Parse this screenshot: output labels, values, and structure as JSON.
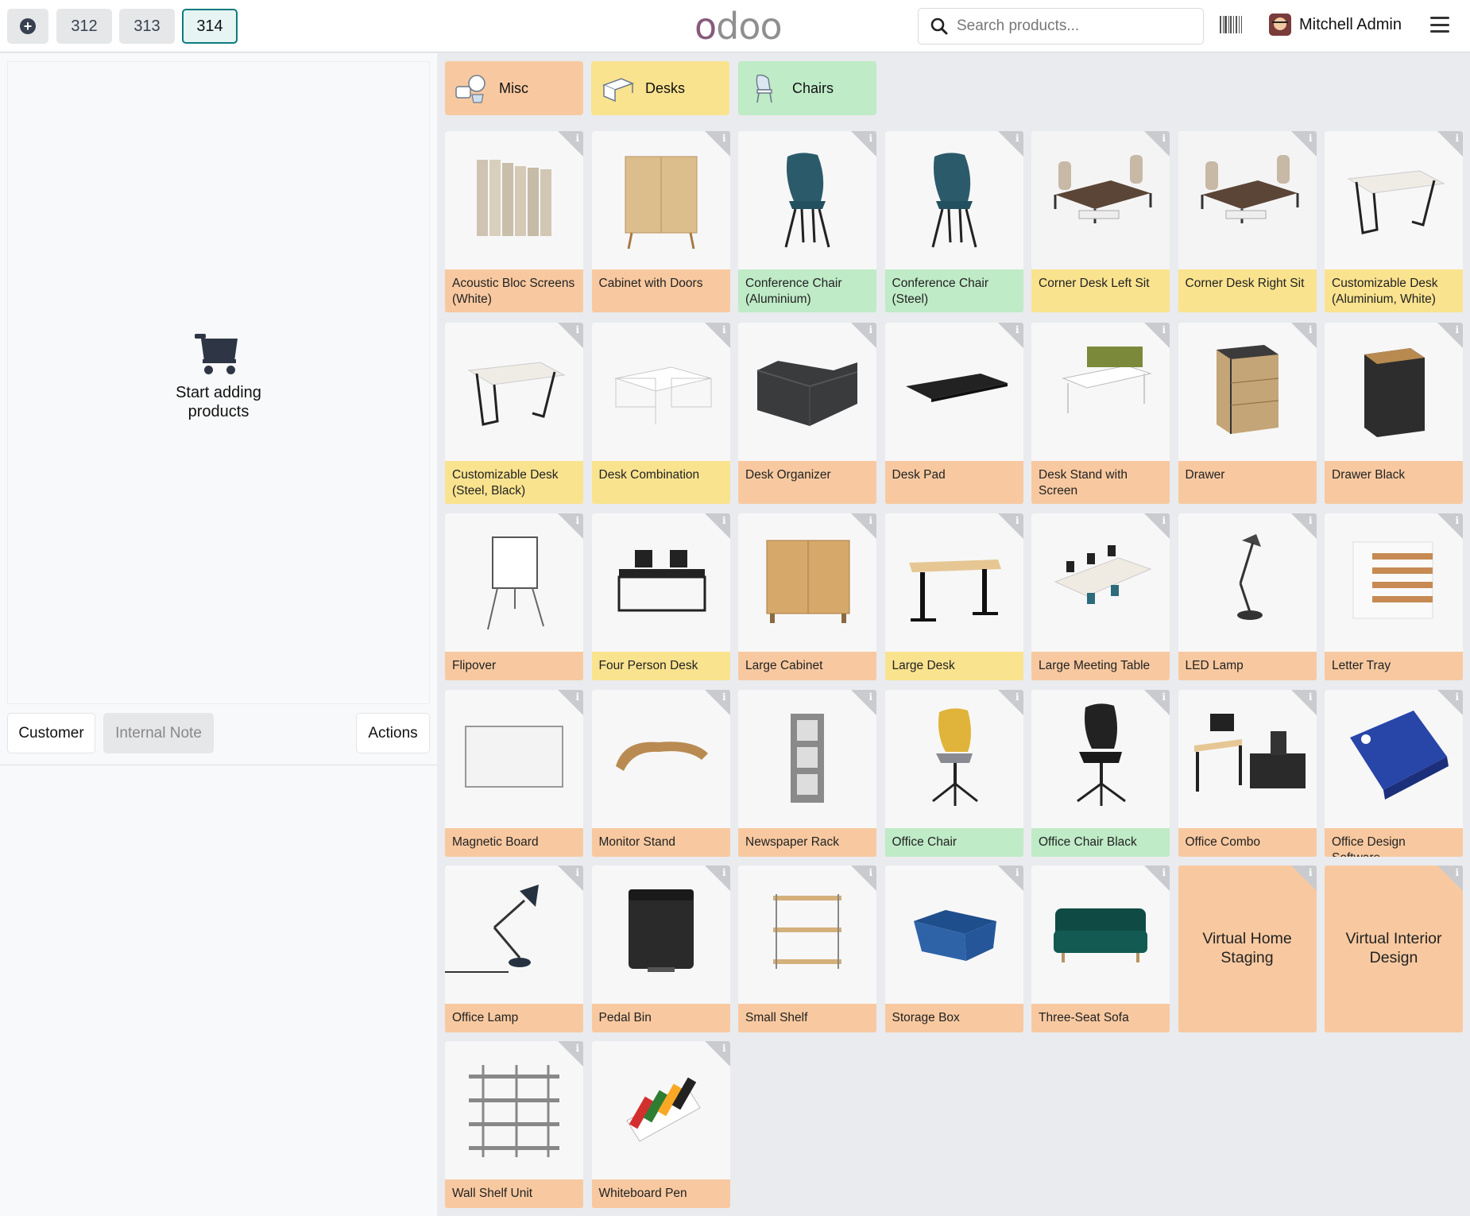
{
  "header": {
    "orders": [
      "312",
      "313",
      "314"
    ],
    "logo": "odoo",
    "search_placeholder": "Search products...",
    "user_name": "Mitchell Admin"
  },
  "order_panel": {
    "empty_text": "Start adding products",
    "buttons": {
      "customer": "Customer",
      "internal_note": "Internal Note",
      "actions": "Actions"
    }
  },
  "categories": [
    "Misc",
    "Desks",
    "Chairs"
  ],
  "colors": {
    "misc": "#f8c9a0",
    "desks": "#fae38f",
    "chairs": "#bfebc7",
    "accent": "#0c7b7f"
  },
  "products": [
    {
      "name": "Acoustic Bloc Screens (White)",
      "category": "misc",
      "icon": "screens"
    },
    {
      "name": "Cabinet with Doors",
      "category": "misc",
      "icon": "cabinet"
    },
    {
      "name": "Conference Chair (Aluminium)",
      "category": "chairs",
      "icon": "chair"
    },
    {
      "name": "Conference Chair (Steel)",
      "category": "chairs",
      "icon": "chair"
    },
    {
      "name": "Corner Desk Left Sit",
      "category": "desks",
      "icon": "corner-desk"
    },
    {
      "name": "Corner Desk Right Sit",
      "category": "desks",
      "icon": "corner-desk"
    },
    {
      "name": "Customizable Desk (Aluminium, White)",
      "category": "desks",
      "icon": "table"
    },
    {
      "name": "Customizable Desk (Steel, Black)",
      "category": "desks",
      "icon": "table"
    },
    {
      "name": "Desk Combination",
      "category": "desks",
      "icon": "desk-combo"
    },
    {
      "name": "Desk Organizer",
      "category": "misc",
      "icon": "organizer"
    },
    {
      "name": "Desk Pad",
      "category": "misc",
      "icon": "pad"
    },
    {
      "name": "Desk Stand with Screen",
      "category": "misc",
      "icon": "stand"
    },
    {
      "name": "Drawer",
      "category": "misc",
      "icon": "drawer"
    },
    {
      "name": "Drawer Black",
      "category": "misc",
      "icon": "drawer-black"
    },
    {
      "name": "Flipover",
      "category": "misc",
      "icon": "flipover"
    },
    {
      "name": "Four Person Desk",
      "category": "desks",
      "icon": "four-desk"
    },
    {
      "name": "Large Cabinet",
      "category": "misc",
      "icon": "large-cabinet"
    },
    {
      "name": "Large Desk",
      "category": "desks",
      "icon": "large-desk"
    },
    {
      "name": "Large Meeting Table",
      "category": "misc",
      "icon": "meeting-table"
    },
    {
      "name": "LED Lamp",
      "category": "misc",
      "icon": "lamp"
    },
    {
      "name": "Letter Tray",
      "category": "misc",
      "icon": "tray"
    },
    {
      "name": "Magnetic Board",
      "category": "misc",
      "icon": "board"
    },
    {
      "name": "Monitor Stand",
      "category": "misc",
      "icon": "monitor-stand"
    },
    {
      "name": "Newspaper Rack",
      "category": "misc",
      "icon": "rack"
    },
    {
      "name": "Office Chair",
      "category": "chairs",
      "icon": "office-chair"
    },
    {
      "name": "Office Chair Black",
      "category": "chairs",
      "icon": "office-chair-black"
    },
    {
      "name": "Office Combo",
      "category": "misc",
      "icon": "combo"
    },
    {
      "name": "Office Design Software",
      "category": "misc",
      "icon": "software"
    },
    {
      "name": "Office Lamp",
      "category": "misc",
      "icon": "office-lamp"
    },
    {
      "name": "Pedal Bin",
      "category": "misc",
      "icon": "bin"
    },
    {
      "name": "Small Shelf",
      "category": "misc",
      "icon": "shelf"
    },
    {
      "name": "Storage Box",
      "category": "misc",
      "icon": "box"
    },
    {
      "name": "Three-Seat Sofa",
      "category": "misc",
      "icon": "sofa"
    },
    {
      "name": "Virtual Home Staging",
      "category": "misc",
      "icon": "",
      "text_only": true
    },
    {
      "name": "Virtual Interior Design",
      "category": "misc",
      "icon": "",
      "text_only": true
    },
    {
      "name": "Wall Shelf Unit",
      "category": "misc",
      "icon": "wall-shelf"
    },
    {
      "name": "Whiteboard Pen",
      "category": "misc",
      "icon": "pens"
    }
  ]
}
